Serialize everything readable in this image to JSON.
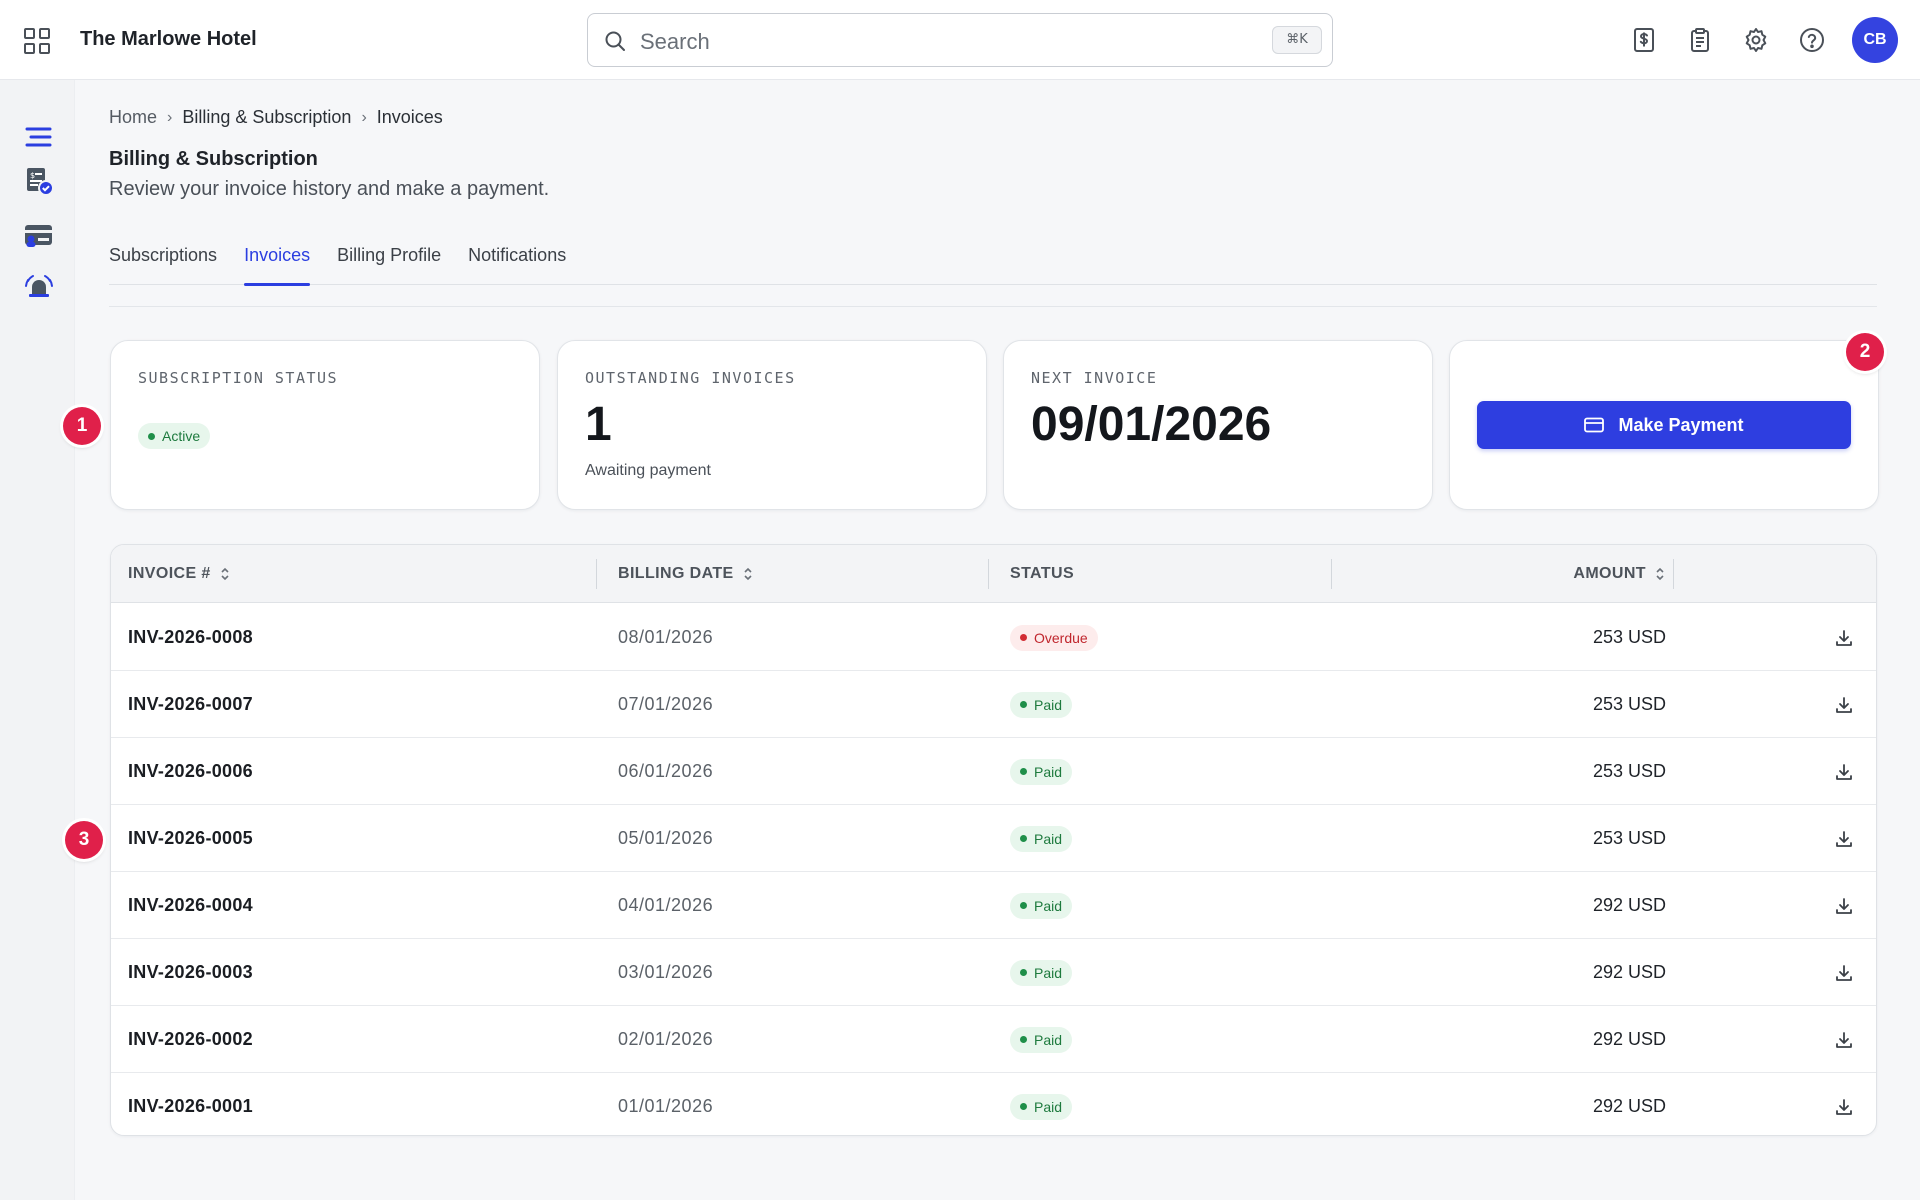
{
  "app": {
    "title": "The Marlowe Hotel"
  },
  "search": {
    "placeholder": "Search",
    "shortcut": "⌘K"
  },
  "user": {
    "initials": "CB"
  },
  "top_icons": [
    "billing-icon",
    "clipboard-icon",
    "gear-icon",
    "help-icon"
  ],
  "rail_icons": [
    "menu-icon",
    "invoice-check-icon",
    "card-user-icon",
    "alarm-bell-icon"
  ],
  "breadcrumb": {
    "home": "Home",
    "section": "Billing & Subscription",
    "current": "Invoices"
  },
  "page": {
    "title": "Billing & Subscription",
    "subtitle": "Review your invoice history and make a payment."
  },
  "tabs": [
    {
      "label": "Subscriptions",
      "active": false
    },
    {
      "label": "Invoices",
      "active": true
    },
    {
      "label": "Billing Profile",
      "active": false
    },
    {
      "label": "Notifications",
      "active": false
    }
  ],
  "cards": {
    "subscription": {
      "label": "SUBSCRIPTION STATUS",
      "status": "Active"
    },
    "outstanding": {
      "label": "OUTSTANDING INVOICES",
      "value": "1",
      "sub": "Awaiting payment"
    },
    "next": {
      "label": "NEXT INVOICE",
      "value": "09/01/2026"
    },
    "payment": {
      "button": "Make Payment"
    }
  },
  "markers": [
    "1",
    "2",
    "3"
  ],
  "table": {
    "headers": {
      "invoice": "INVOICE #",
      "date": "BILLING DATE",
      "status": "STATUS",
      "amount": "AMOUNT"
    },
    "rows": [
      {
        "invoice": "INV-2026-0008",
        "date": "08/01/2026",
        "status": "Overdue",
        "amount": "253 USD"
      },
      {
        "invoice": "INV-2026-0007",
        "date": "07/01/2026",
        "status": "Paid",
        "amount": "253 USD"
      },
      {
        "invoice": "INV-2026-0006",
        "date": "06/01/2026",
        "status": "Paid",
        "amount": "253 USD"
      },
      {
        "invoice": "INV-2026-0005",
        "date": "05/01/2026",
        "status": "Paid",
        "amount": "253 USD"
      },
      {
        "invoice": "INV-2026-0004",
        "date": "04/01/2026",
        "status": "Paid",
        "amount": "292 USD"
      },
      {
        "invoice": "INV-2026-0003",
        "date": "03/01/2026",
        "status": "Paid",
        "amount": "292 USD"
      },
      {
        "invoice": "INV-2026-0002",
        "date": "02/01/2026",
        "status": "Paid",
        "amount": "292 USD"
      },
      {
        "invoice": "INV-2026-0001",
        "date": "01/01/2026",
        "status": "Paid",
        "amount": "292 USD"
      }
    ]
  },
  "colors": {
    "accent": "#2e3ee0",
    "marker": "#e0204a",
    "paid": "#1e7a3e",
    "overdue": "#c0262d"
  }
}
